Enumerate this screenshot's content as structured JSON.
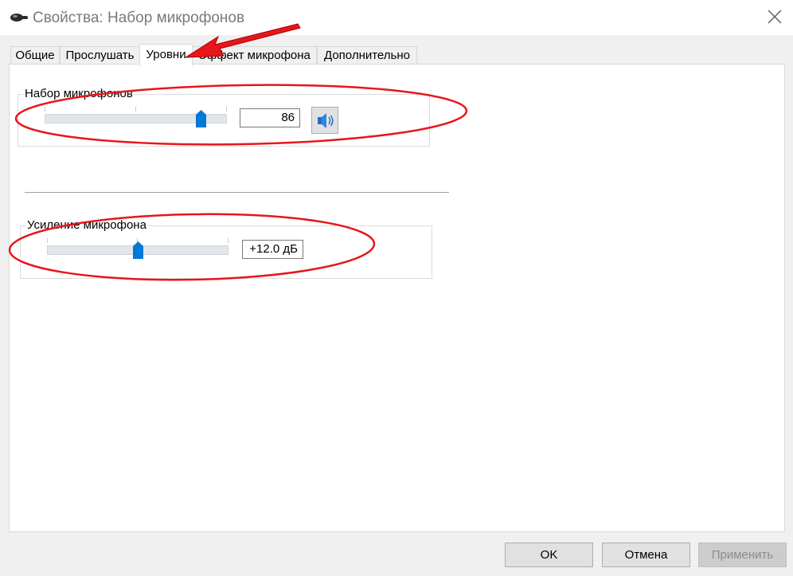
{
  "window": {
    "title": "Свойства: Набор микрофонов",
    "icon": "microphone-icon",
    "close_icon": "close-icon"
  },
  "tabs": [
    {
      "label": "Общие",
      "active": false
    },
    {
      "label": "Прослушать",
      "active": false
    },
    {
      "label": "Уровни",
      "active": true
    },
    {
      "label": "Эффект микрофона",
      "active": false
    },
    {
      "label": "Дополнительно",
      "active": false
    }
  ],
  "levels": {
    "microphone": {
      "label": "Набор микрофонов",
      "value": "86",
      "slider_percent": 86,
      "mute_icon": "speaker-icon"
    },
    "boost": {
      "label": "Усиление микрофона",
      "value": "+12.0 дБ",
      "slider_fraction": 0.5
    }
  },
  "buttons": {
    "ok": "OK",
    "cancel": "Отмена",
    "apply": "Применить"
  },
  "colors": {
    "thumb": "#0078d7",
    "annotation": "#e8151b"
  }
}
